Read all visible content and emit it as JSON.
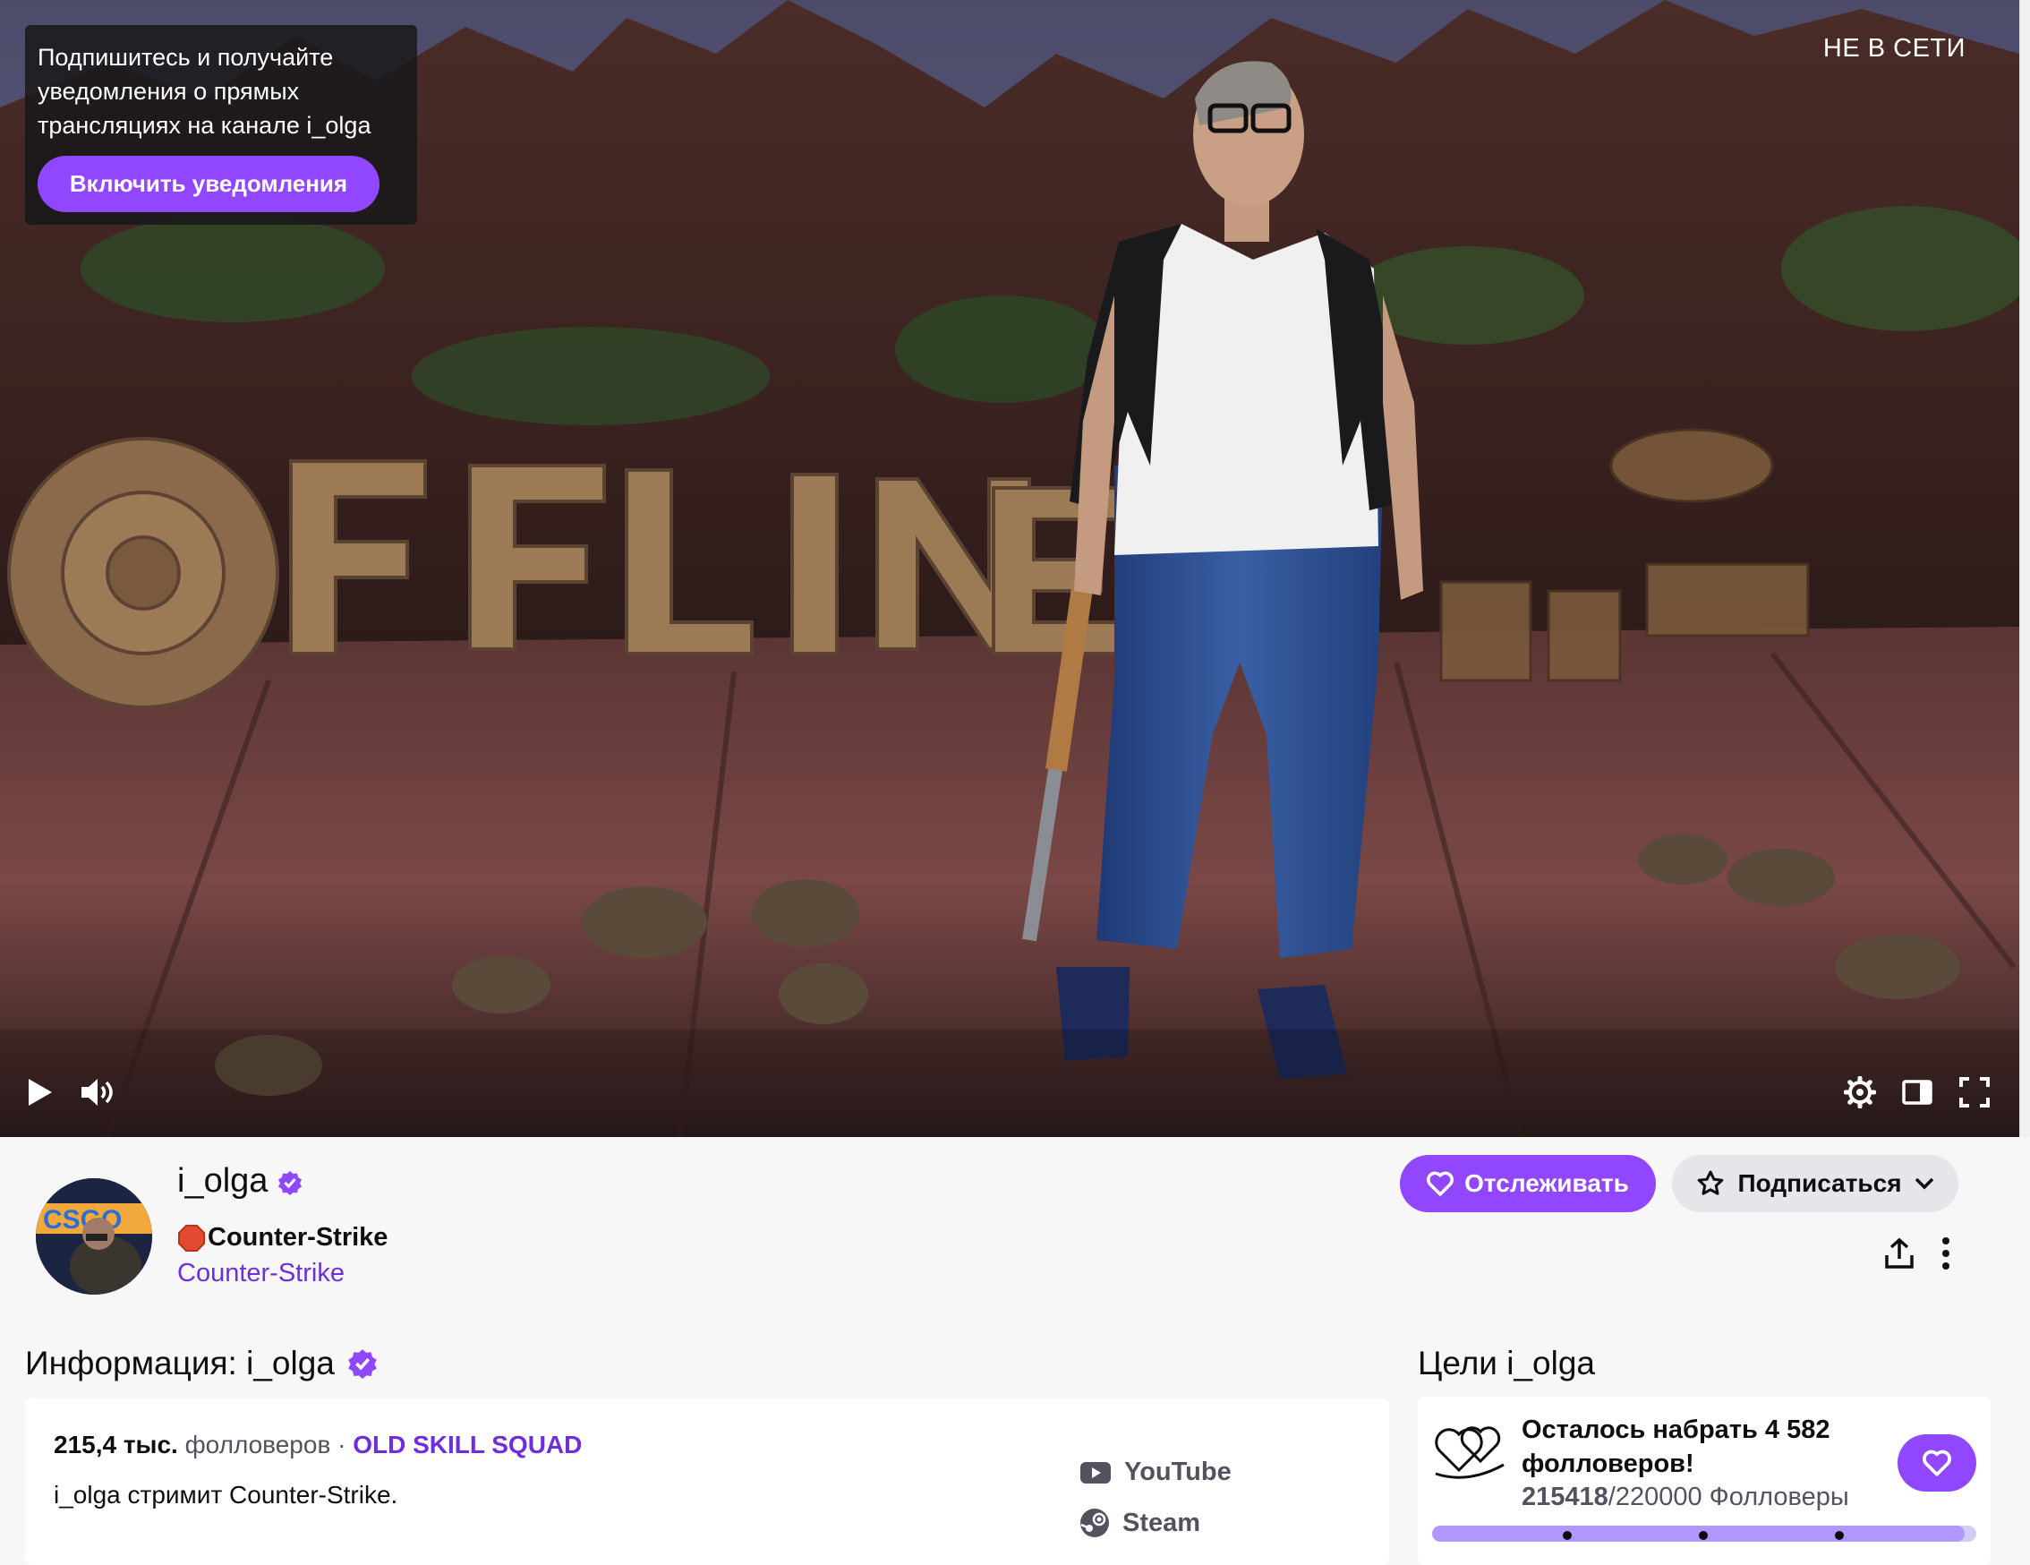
{
  "player": {
    "notification_text": "Подпишитесь и получайте уведомления о прямых трансляциях на канале i_olga",
    "notification_button": "Включить уведомления",
    "status_label": "НЕ В СЕТИ",
    "controls": [
      "play-icon",
      "volume-icon",
      "settings-icon",
      "theatre-mode-icon",
      "fullscreen-icon"
    ]
  },
  "channel": {
    "name": "i_olga",
    "stream_title": "Counter-Strike",
    "category": "Counter-Strike",
    "follow_label": "Отслеживать",
    "subscribe_label": "Подписаться"
  },
  "about": {
    "heading": "Информация: i_olga",
    "followers_count": "215,4 тыс.",
    "followers_word": "фолловеров",
    "separator": "·",
    "team": "OLD SKILL SQUAD",
    "bio": "i_olga стримит Counter-Strike.",
    "links": [
      {
        "label": "YouTube",
        "icon": "youtube-icon"
      },
      {
        "label": "Steam",
        "icon": "steam-icon"
      }
    ]
  },
  "goals": {
    "heading": "Цели i_olga",
    "title": "Осталось набрать 4 582 фолловеров!",
    "current": "215418",
    "target": "/220000",
    "unit": "Фолловеры",
    "progress_fraction": 0.979
  },
  "colors": {
    "accent": "#9147ff",
    "link": "#6f2edb",
    "background": "#f7f7f8"
  }
}
